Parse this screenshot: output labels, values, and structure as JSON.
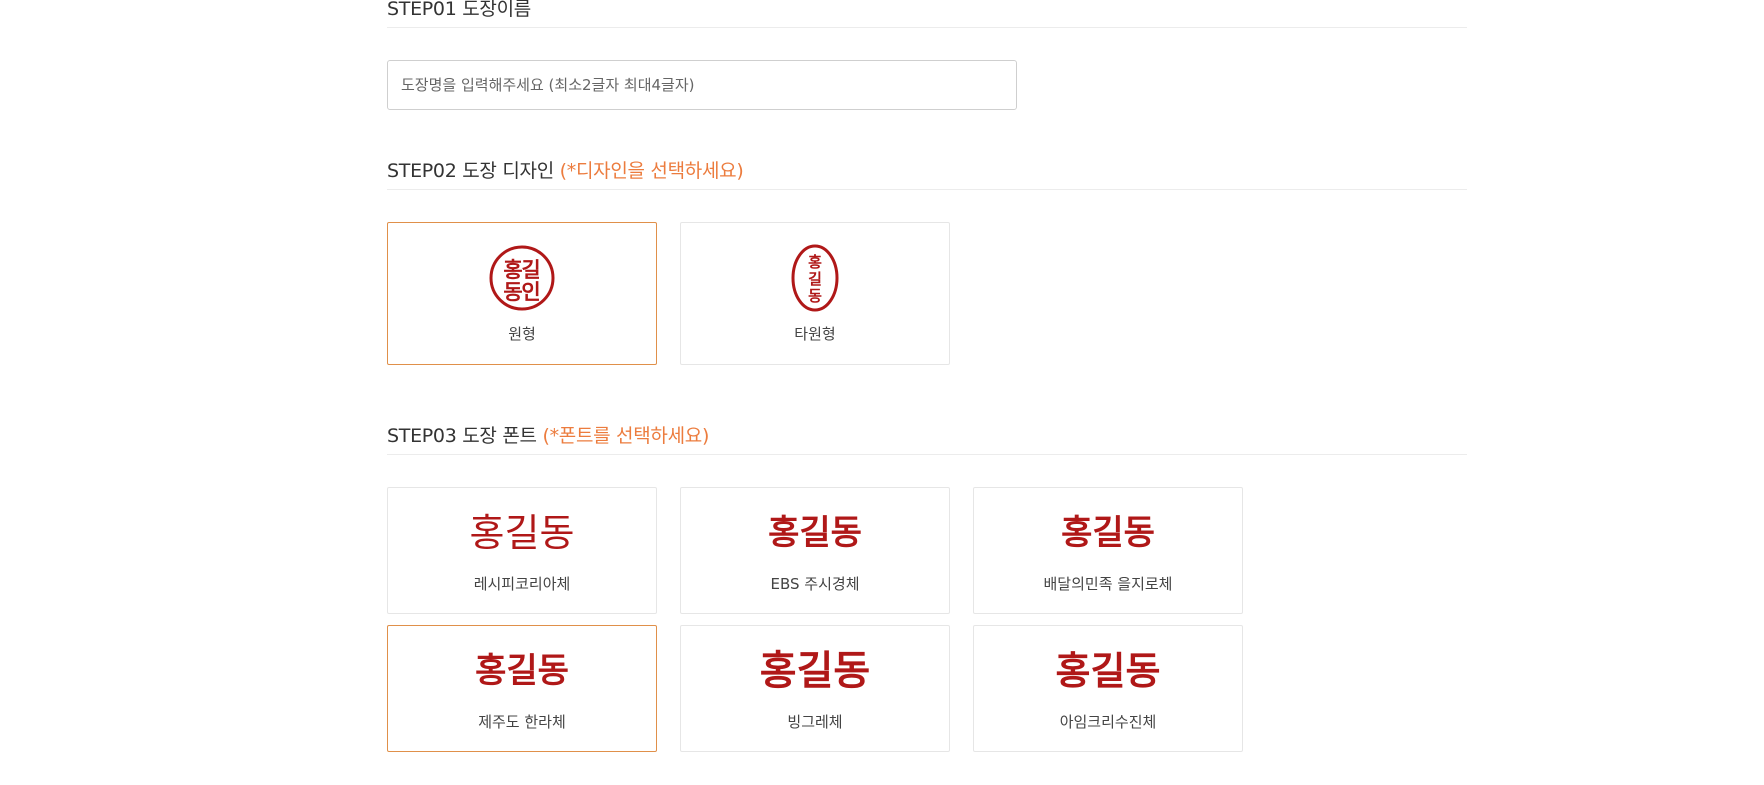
{
  "step1": {
    "title": "STEP01 도장이름",
    "input_placeholder": "도장명을 입력해주세요 (최소2글자 최대4글자)"
  },
  "step2": {
    "title": "STEP02 도장 디자인",
    "hint": "(*디자인을 선택하세요)",
    "designs": [
      {
        "label": "원형",
        "seal_chars": [
          "홍",
          "길",
          "동",
          "인"
        ],
        "selected": true
      },
      {
        "label": "타원형",
        "seal_chars": [
          "홍",
          "길",
          "동"
        ],
        "selected": false
      }
    ]
  },
  "step3": {
    "title": "STEP03 도장 폰트",
    "hint": "(*폰트를 선택하세요)",
    "sample_text": "홍길동",
    "fonts": [
      {
        "label": "레시피코리아체",
        "selected": false
      },
      {
        "label": "EBS 주시경체",
        "selected": false
      },
      {
        "label": "배달의민족 을지로체",
        "selected": false
      },
      {
        "label": "제주도 한라체",
        "selected": true
      },
      {
        "label": "빙그레체",
        "selected": false
      },
      {
        "label": "아임크리수진체",
        "selected": false
      }
    ]
  },
  "colors": {
    "accent": "#ec7c3e",
    "selected_border": "#e0904a",
    "seal_red": "#b01818",
    "text": "#333333",
    "divider": "#ececec"
  }
}
